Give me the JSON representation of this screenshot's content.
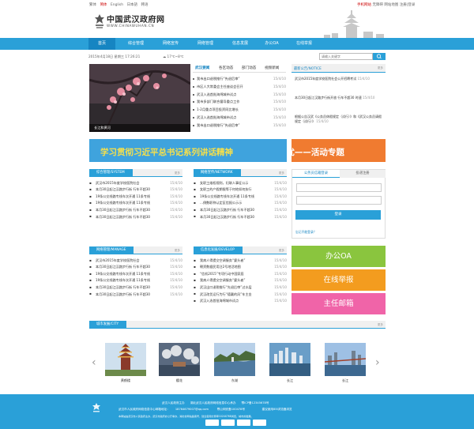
{
  "topbar": {
    "lang": [
      "繁体",
      "简体",
      "English",
      "日本語",
      "韩语"
    ],
    "links": [
      "手机网站",
      "无障碍",
      "网站地图",
      "注册|登录"
    ]
  },
  "header": {
    "title": "中国武汉政府网",
    "url": "WWW.CHINAWUHAN.CN"
  },
  "nav": [
    "首页",
    "综合管理",
    "网络宣传",
    "网络管理",
    "信息发展",
    "办公OA",
    "在线举报"
  ],
  "datebar": {
    "date": "2015年4月18日  星期三 17:26:21",
    "weather": "17℃~8℃",
    "search_placeholder": "请输入关键字"
  },
  "photo": {
    "caption": "长江和黄河"
  },
  "news": {
    "tabs": [
      "武汉要闻",
      "各区动态",
      "部门动态",
      "视频新闻"
    ],
    "items": [
      {
        "title": "我市出口退税推行“先退后审”",
        "date": "15/4/10"
      },
      {
        "title": "市区人大常委会主任座谈会召开",
        "date": "15/4/10"
      },
      {
        "title": "武汉入选首批海绵城市试点",
        "date": "15/4/10"
      },
      {
        "title": "我市多部门联合督导重点工作",
        "date": "15/4/10"
      },
      {
        "title": "1-2月重点项目投资同比增长",
        "date": "15/4/10"
      },
      {
        "title": "武汉入选首批海绵城市试点",
        "date": "15/4/10"
      },
      {
        "title": "我市出口退税推行“先退后审”",
        "date": "15/4/10"
      }
    ]
  },
  "notice": {
    "label": "最新公告/NOTICE",
    "more": "更多",
    "items": [
      {
        "text": "武汉市2015年度学校医院社会公开招聘考试",
        "date": "15/4/10"
      },
      {
        "text": "本月30日起江汉路步行街开放 行车不超30 时速",
        "date": "15/4/10"
      },
      {
        "text": "根据公告汉武《公务员休假规定（试行）》和《武汉公务员请假规定（试行）》",
        "date": "15/4/10"
      }
    ]
  },
  "banners": {
    "left": "学习贯彻习近平总书记系列讲话精神",
    "right": "武汉政府网站”争先创优——活动专题"
  },
  "sections": [
    {
      "label": "综合管理/SYSTEM",
      "more": "更多",
      "items": [
        {
          "title": "武汉市2015年度学校医院社会",
          "date": "15/4/10"
        },
        {
          "title": "本月30日起江汉路步行街 行车不超30",
          "date": "15/4/10"
        },
        {
          "title": "19条公交线路专线车次开通 11条专线",
          "date": "15/4/10"
        },
        {
          "title": "19条公交线路专线车次开通 11条专线",
          "date": "15/4/10"
        },
        {
          "title": "本月30日起江汉路步行街 行车不超30",
          "date": "15/4/10"
        },
        {
          "title": "本月30日起江汉路步行街 行车不超30",
          "date": "15/4/10"
        }
      ]
    },
    {
      "label": "网络宣传/NETWORK",
      "more": "更多",
      "items": [
        {
          "title": "女职工维权规则，妇联人事征公示",
          "date": "15/4/10"
        },
        {
          "title": "女职工的产假期限等于何地如何执行",
          "date": "15/4/10"
        },
        {
          "title": "19条公交线路专线车次开通 11条专线",
          "date": "15/4/10"
        },
        {
          "title": "…倒数职称认定区信报公示示",
          "date": "15/4/10"
        },
        {
          "title": "本月30日起江汉路步行街 行车不超30",
          "date": "15/4/10"
        },
        {
          "title": "本月30日起江汉路步行街 行车不超30",
          "date": "15/4/10"
        }
      ]
    },
    {
      "label": "网络管理/MANAGE",
      "more": "更多",
      "items": [
        {
          "title": "武汉市2015年度学校医院社会",
          "date": "15/4/10"
        },
        {
          "title": "本月30日起江汉路步行街 行车不超30",
          "date": "15/4/10"
        },
        {
          "title": "19条公交线路专线车次开通 11条专线",
          "date": "15/4/10"
        },
        {
          "title": "19条公交线路专线车次开通 11条专线",
          "date": "15/4/10"
        },
        {
          "title": "本月30日起江汉路步行街 行车不超30",
          "date": "15/4/10"
        },
        {
          "title": "本月30日起江汉路步行街 行车不超30",
          "date": "15/4/10"
        }
      ]
    },
    {
      "label": "信息化发展/DEVELOP",
      "more": "更多",
      "items": [
        {
          "title": "我病人得提交空调服务“婆头者”",
          "date": "15/4/10"
        },
        {
          "title": "朝资数据民用注2号地活地图",
          "date": "15/4/10"
        },
        {
          "title": "“信机2015”专项行动中国家庭",
          "date": "15/4/10"
        },
        {
          "title": "我病人得提交空调服务“婆头者”",
          "date": "15/4/10"
        },
        {
          "title": "武汉出口退税推行“先退后审”过水层",
          "date": "15/4/10"
        },
        {
          "title": "武汉改货运行为行“德戴的风”车主金",
          "date": "15/4/10"
        },
        {
          "title": "武汉入选首批海绵城市试点",
          "date": "15/4/10"
        }
      ]
    }
  ],
  "login": {
    "tab_active": "公务员信箱登录",
    "tab_other": "投递注册",
    "button": "登录",
    "forgot": "忘记不能登录？"
  },
  "side_buttons": [
    {
      "label": "办公OA",
      "color": "#8ac53e"
    },
    {
      "label": "在线举报",
      "color": "#f39c1f"
    },
    {
      "label": "主任邮箱",
      "color": "#f064a8"
    }
  ],
  "city": {
    "label": "城市发展/CITY",
    "more": "更多",
    "photos": [
      "黄鹤楼",
      "樱花",
      "东湖",
      "长江",
      "长江"
    ]
  },
  "footer": {
    "line1": "武汉人民政府主办　　湖北武汉人民政府网络信息中心承办　　鄂ICP备12345678号",
    "line2": "武汉市人民政府网络信息中心邮箱地址：　　18764679007@qq.com　　　鄂公网安备100478号　　　　　　建议使用IE8浏览器浏览",
    "line3": "本网站由武汉市人民政府主办，武汉市政府办公厅承办，湖北省网站备案号，建议使用分辨率1024X768浏览，城市的发展。"
  },
  "colors": {
    "primary": "#2aa0d8",
    "primary_dark": "#1685c2",
    "banner_left": "#3fa3dd",
    "banner_right": "#f07b30"
  }
}
